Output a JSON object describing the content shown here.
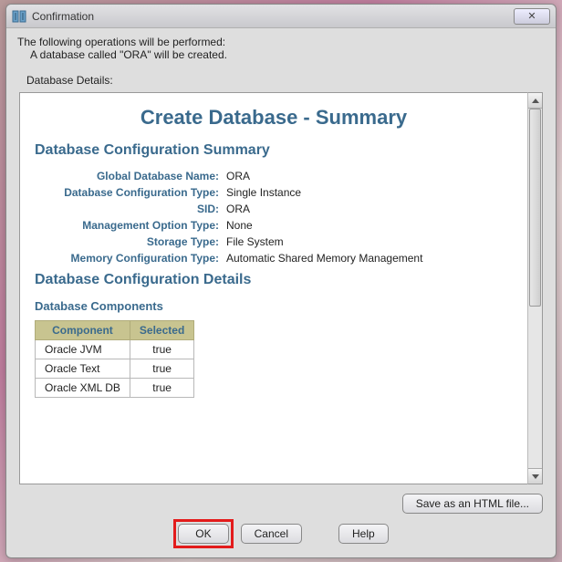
{
  "window": {
    "title": "Confirmation"
  },
  "header": {
    "line1": "The following operations will be performed:",
    "line2": "A database called \"ORA\" will be created.",
    "details_label": "Database Details:"
  },
  "page": {
    "title": "Create Database - Summary",
    "summary_heading": "Database Configuration Summary",
    "fields": {
      "global_db_name": {
        "k": "Global Database Name:",
        "v": "ORA"
      },
      "config_type": {
        "k": "Database Configuration Type:",
        "v": "Single Instance"
      },
      "sid": {
        "k": "SID:",
        "v": "ORA"
      },
      "mgmt_option": {
        "k": "Management Option Type:",
        "v": "None"
      },
      "storage_type": {
        "k": "Storage Type:",
        "v": "File System"
      },
      "mem_config": {
        "k": "Memory Configuration Type:",
        "v": "Automatic Shared Memory Management"
      }
    },
    "details_heading": "Database Configuration Details",
    "components_heading": "Database Components",
    "components_table": {
      "col_component": "Component",
      "col_selected": "Selected",
      "rows": [
        {
          "name": "Oracle JVM",
          "selected": "true"
        },
        {
          "name": "Oracle Text",
          "selected": "true"
        },
        {
          "name": "Oracle XML DB",
          "selected": "true"
        }
      ]
    }
  },
  "buttons": {
    "save_html": "Save as an HTML file...",
    "ok": "OK",
    "cancel": "Cancel",
    "help": "Help"
  }
}
